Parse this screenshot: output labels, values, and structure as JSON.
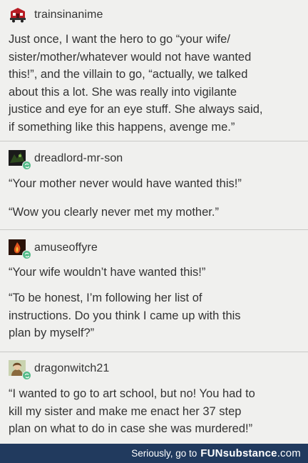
{
  "posts": [
    {
      "username": "trainsinanime",
      "avatar_icon": "train-avatar-icon",
      "paragraphs": [
        "Just once, I want the hero to go “your wife/\nsister/mother/whatever would not have wanted\nthis!”, and the villain to go, “actually, we talked\nabout this a lot. She was really into vigilante\njustice and eye for an eye stuff. She always said,\nif something like this happens, avenge me.”"
      ]
    },
    {
      "username": "dreadlord-mr-son",
      "avatar_icon": "dark-avatar-icon",
      "paragraphs": [
        "“Your mother never would have wanted this!”",
        "“Wow you clearly never met my mother.”"
      ]
    },
    {
      "username": "amuseoffyre",
      "avatar_icon": "fire-avatar-icon",
      "paragraphs": [
        "“Your wife wouldn’t have wanted this!”",
        "“To be honest, I’m following her list of\ninstructions. Do you think I came up with this\nplan by myself?”"
      ]
    },
    {
      "username": "dragonwitch21",
      "avatar_icon": "person-avatar-icon",
      "paragraphs": [
        "“I wanted to go to art school, but no! You had to\nkill my sister and make me enact her 37 step\nplan on what to do in case she was murdered!”"
      ]
    }
  ],
  "footer": {
    "text": "Seriously, go to",
    "brand_bold": "FUNsubstance",
    "brand_light": ".com"
  },
  "colors": {
    "background": "#f0f0ee",
    "footer_bg": "#213a5e",
    "reblog_green": "#56bc8a"
  }
}
